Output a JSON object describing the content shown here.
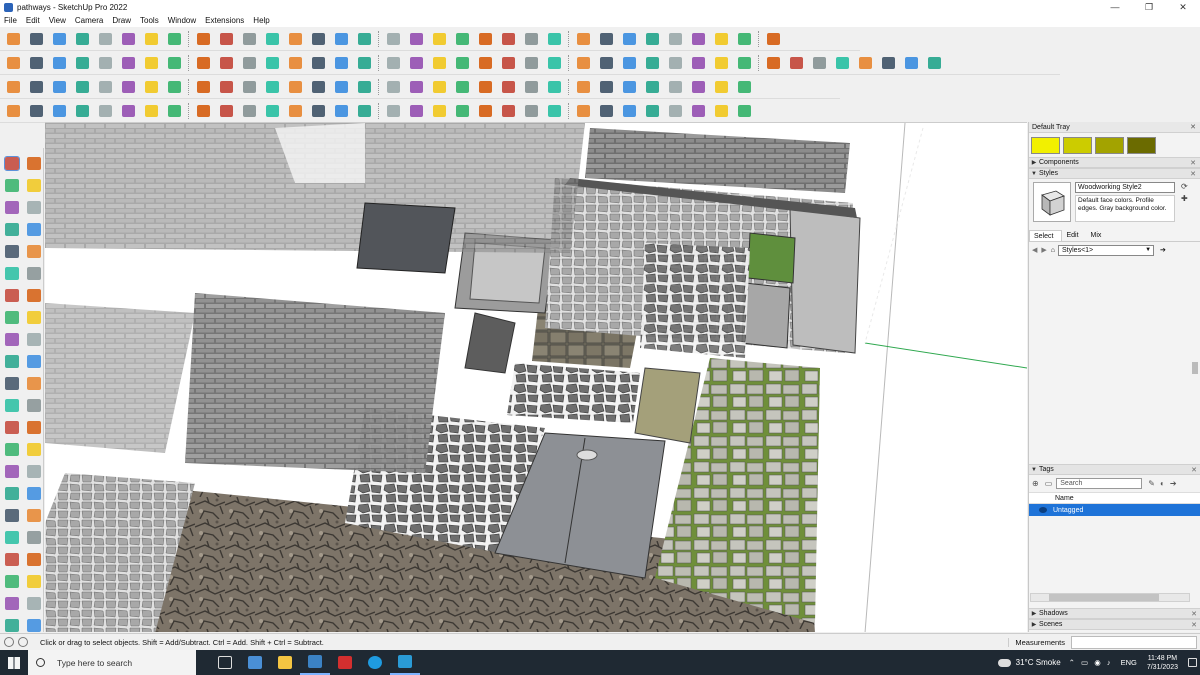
{
  "window": {
    "title": "pathways - SketchUp Pro 2022",
    "minimize": "—",
    "maximize": "❐",
    "close": "✕"
  },
  "menu": [
    "File",
    "Edit",
    "View",
    "Camera",
    "Draw",
    "Tools",
    "Window",
    "Extensions",
    "Help"
  ],
  "colors": {
    "accent": "#1e73d8",
    "swatch1": "#f2f000",
    "swatch2": "#cccc00",
    "swatch3": "#a3a300",
    "swatch4": "#6b6b00"
  },
  "tray": {
    "title": "Default Tray",
    "close": "✕",
    "components": "Components",
    "styles_header": "Styles",
    "style_name": "Woodworking Style2",
    "style_description": "Default face colors. Profile edges. Gray background color.",
    "tabs": [
      "Select",
      "Edit",
      "Mix"
    ],
    "style_collection": "Styles<1>",
    "tags_header": "Tags",
    "search_placeholder": "Search",
    "name_column": "Name",
    "tag_row": "Untagged",
    "shadows": "Shadows",
    "scenes": "Scenes"
  },
  "status": {
    "message": "Click or drag to select objects. Shift = Add/Subtract. Ctrl = Add. Shift + Ctrl = Subtract.",
    "measurements_label": "Measurements"
  },
  "taskbar": {
    "search_placeholder": "Type here to search",
    "weather": "31°C Smoke",
    "language": "ENG",
    "time": "11:48 PM",
    "date": "7/31/2023"
  }
}
